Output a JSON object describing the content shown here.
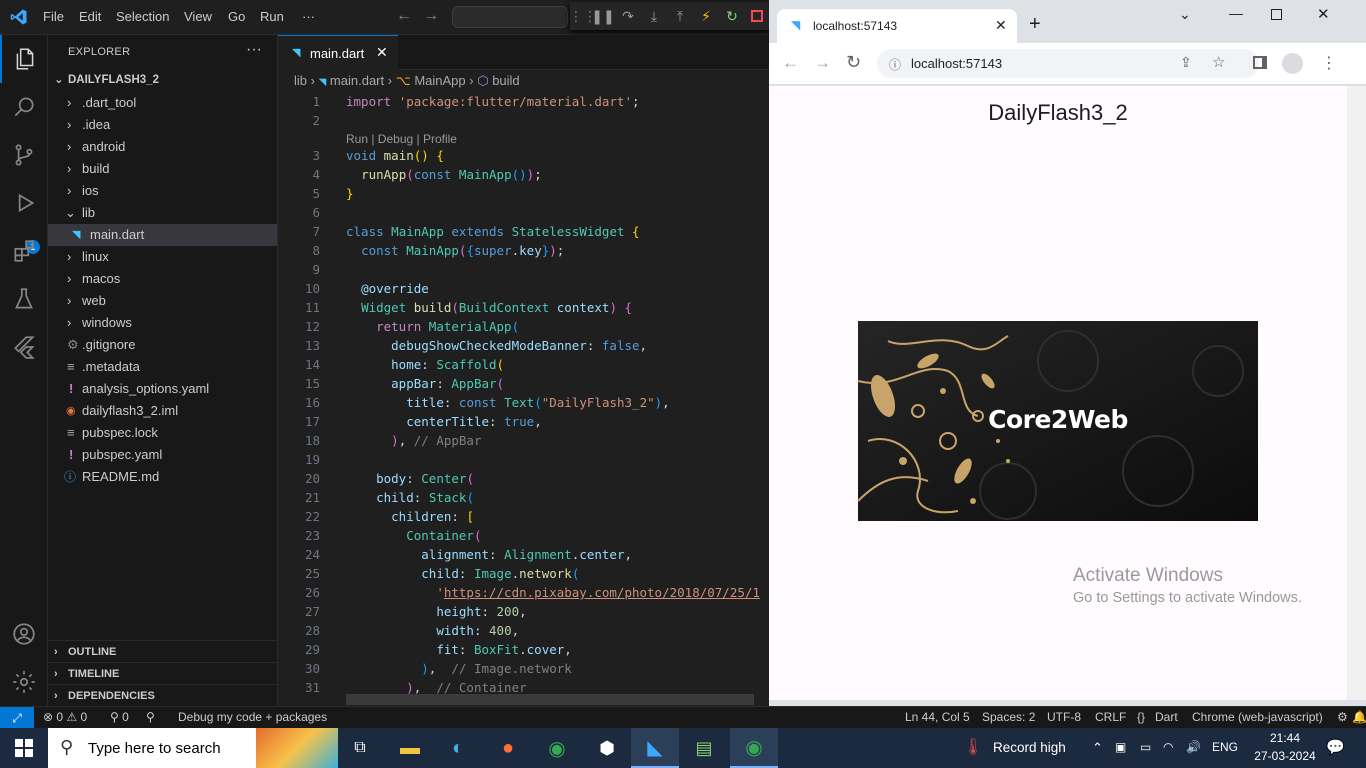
{
  "menu": [
    "File",
    "Edit",
    "Selection",
    "View",
    "Go",
    "Run",
    "···"
  ],
  "explorer": {
    "title": "EXPLORER",
    "project": "DAILYFLASH3_2",
    "items": [
      ".dart_tool",
      ".idea",
      "android",
      "build",
      "ios",
      "lib",
      "main.dart",
      "linux",
      "macos",
      "web",
      "windows",
      ".gitignore",
      ".metadata",
      "analysis_options.yaml",
      "dailyflash3_2.iml",
      "pubspec.lock",
      "pubspec.yaml",
      "README.md"
    ],
    "sections": [
      "OUTLINE",
      "TIMELINE",
      "DEPENDENCIES"
    ],
    "debug_badge": "1"
  },
  "editor": {
    "tab": "main.dart",
    "breadcrumb": [
      "lib",
      "main.dart",
      "MainApp",
      "build"
    ],
    "codelens": "Run | Debug | Profile",
    "line_numbers": [
      "1",
      "2",
      "3",
      "4",
      "5",
      "6",
      "7",
      "8",
      "9",
      "10",
      "11",
      "12",
      "13",
      "14",
      "15",
      "16",
      "17",
      "18",
      "19",
      "20",
      "21",
      "22",
      "23",
      "24",
      "25",
      "26",
      "27",
      "28",
      "29",
      "30",
      "31"
    ]
  },
  "status": {
    "problems": "0",
    "warnings": "0",
    "ports": "0",
    "debug": "Debug my code + packages",
    "position": "Ln 44, Col 5",
    "spaces": "Spaces: 2",
    "encoding": "UTF-8",
    "eol": "CRLF",
    "language": "Dart",
    "device": "Chrome (web-javascript)"
  },
  "browser": {
    "tab_title": "localhost:57143",
    "url": "localhost:57143",
    "app_title": "DailyFlash3_2",
    "banner_text": "Core2Web",
    "activate_title": "Activate Windows",
    "activate_sub": "Go to Settings to activate Windows."
  },
  "taskbar": {
    "search_placeholder": "Type here to search",
    "weather": "Record high",
    "lang": "ENG",
    "time": "21:44",
    "date": "27-03-2024"
  },
  "colors": {
    "accent": "#0078d4",
    "editor_bg": "#1f1f1f",
    "sidebar_bg": "#181818",
    "taskbar_bg": "#1b2a3f"
  }
}
